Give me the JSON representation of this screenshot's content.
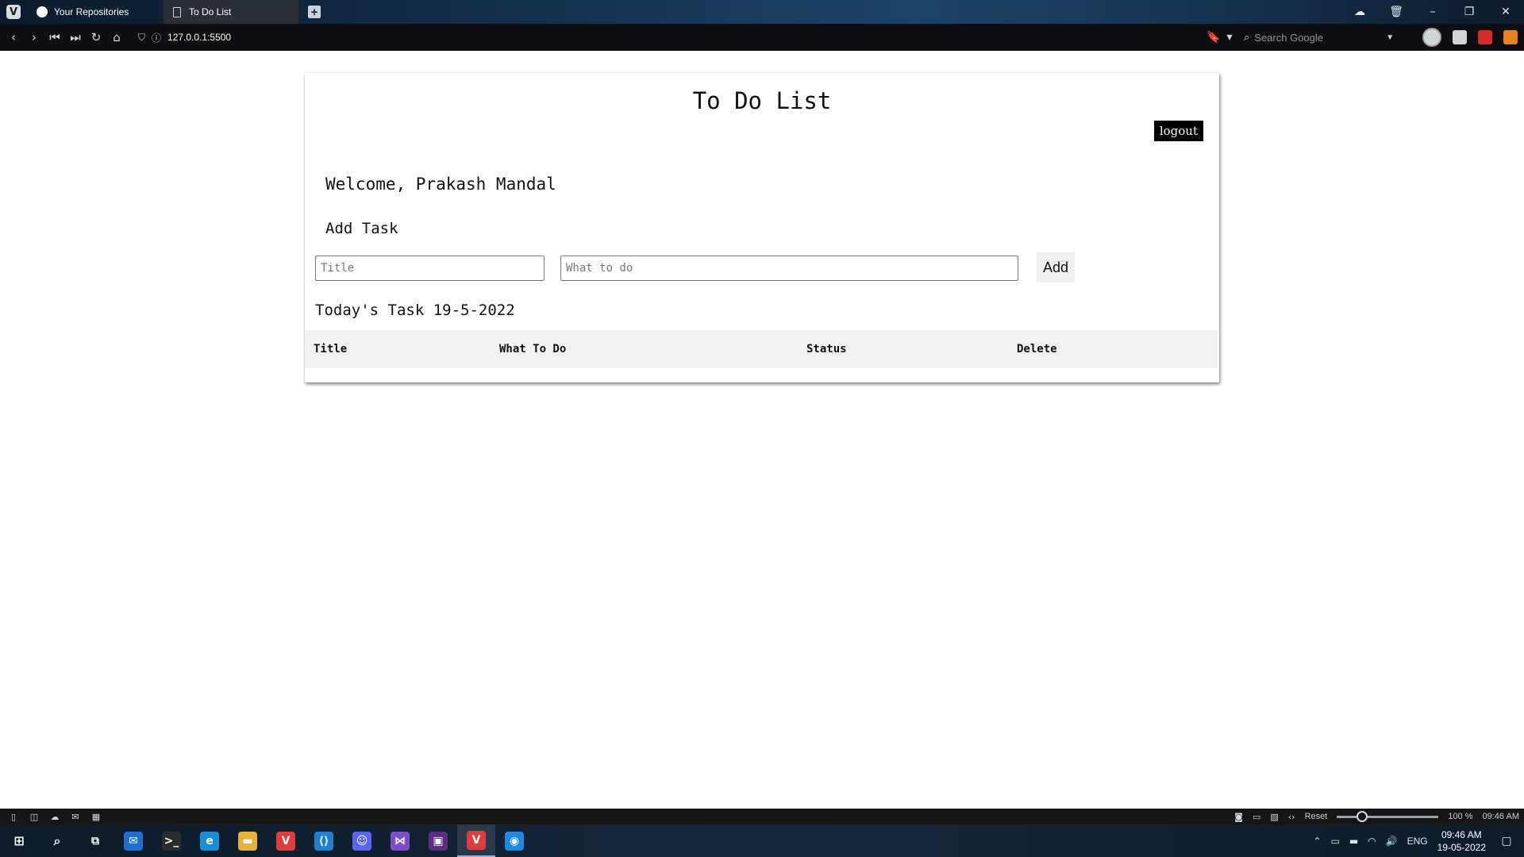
{
  "browser": {
    "tabs": [
      {
        "label": "Your Repositories",
        "icon": "github-icon"
      },
      {
        "label": "To Do List",
        "icon": "document-icon"
      }
    ],
    "new_tab_glyph": "+",
    "window_controls": {
      "minimize": "–",
      "restore": "❐",
      "close": "✕"
    },
    "nav_glyphs": {
      "back": "‹",
      "forward": "›",
      "rewind": "⏮",
      "fast_forward": "⏭",
      "reload": "↻",
      "home": "⌂"
    },
    "address": "127.0.0.1:5500",
    "search_placeholder": "Search Google",
    "status_bar": {
      "reset_label": "Reset",
      "zoom_level": "100 %",
      "zoom_fraction": 0.25,
      "time": "09:46 AM"
    }
  },
  "page": {
    "title": "To Do List",
    "logout_label": "logout",
    "welcome_text": "Welcome, Prakash Mandal",
    "add_task_label": "Add Task",
    "title_placeholder": "Title",
    "todo_placeholder": "What to do",
    "add_button_label": "Add",
    "today_label": "Today's Task 19-5-2022",
    "table_headers": [
      "Title",
      "What To Do",
      "Status",
      "Delete"
    ]
  },
  "taskbar": {
    "apps": [
      {
        "name": "mail",
        "color": "#1f6fd1",
        "glyph": "✉"
      },
      {
        "name": "terminal",
        "color": "#2c2c2c",
        "glyph": ">_"
      },
      {
        "name": "edge",
        "color": "#1a8fd8",
        "glyph": "e"
      },
      {
        "name": "file-explorer",
        "color": "#e8b23a",
        "glyph": "▬"
      },
      {
        "name": "vivaldi",
        "color": "#e03c3c",
        "glyph": "V"
      },
      {
        "name": "vscode",
        "color": "#1f7fd0",
        "glyph": "⟨⟩"
      },
      {
        "name": "discord",
        "color": "#5865f2",
        "glyph": "☺"
      },
      {
        "name": "visual-studio",
        "color": "#7c4dc4",
        "glyph": "⋈"
      },
      {
        "name": "rider",
        "color": "#5a2d82",
        "glyph": "▣"
      },
      {
        "name": "vivaldi-active",
        "color": "#e03c3c",
        "glyph": "V"
      },
      {
        "name": "firefox-dev",
        "color": "#1e88e5",
        "glyph": "◉"
      }
    ],
    "language": "ENG",
    "time": "09:46 AM",
    "date": "19-05-2022"
  }
}
